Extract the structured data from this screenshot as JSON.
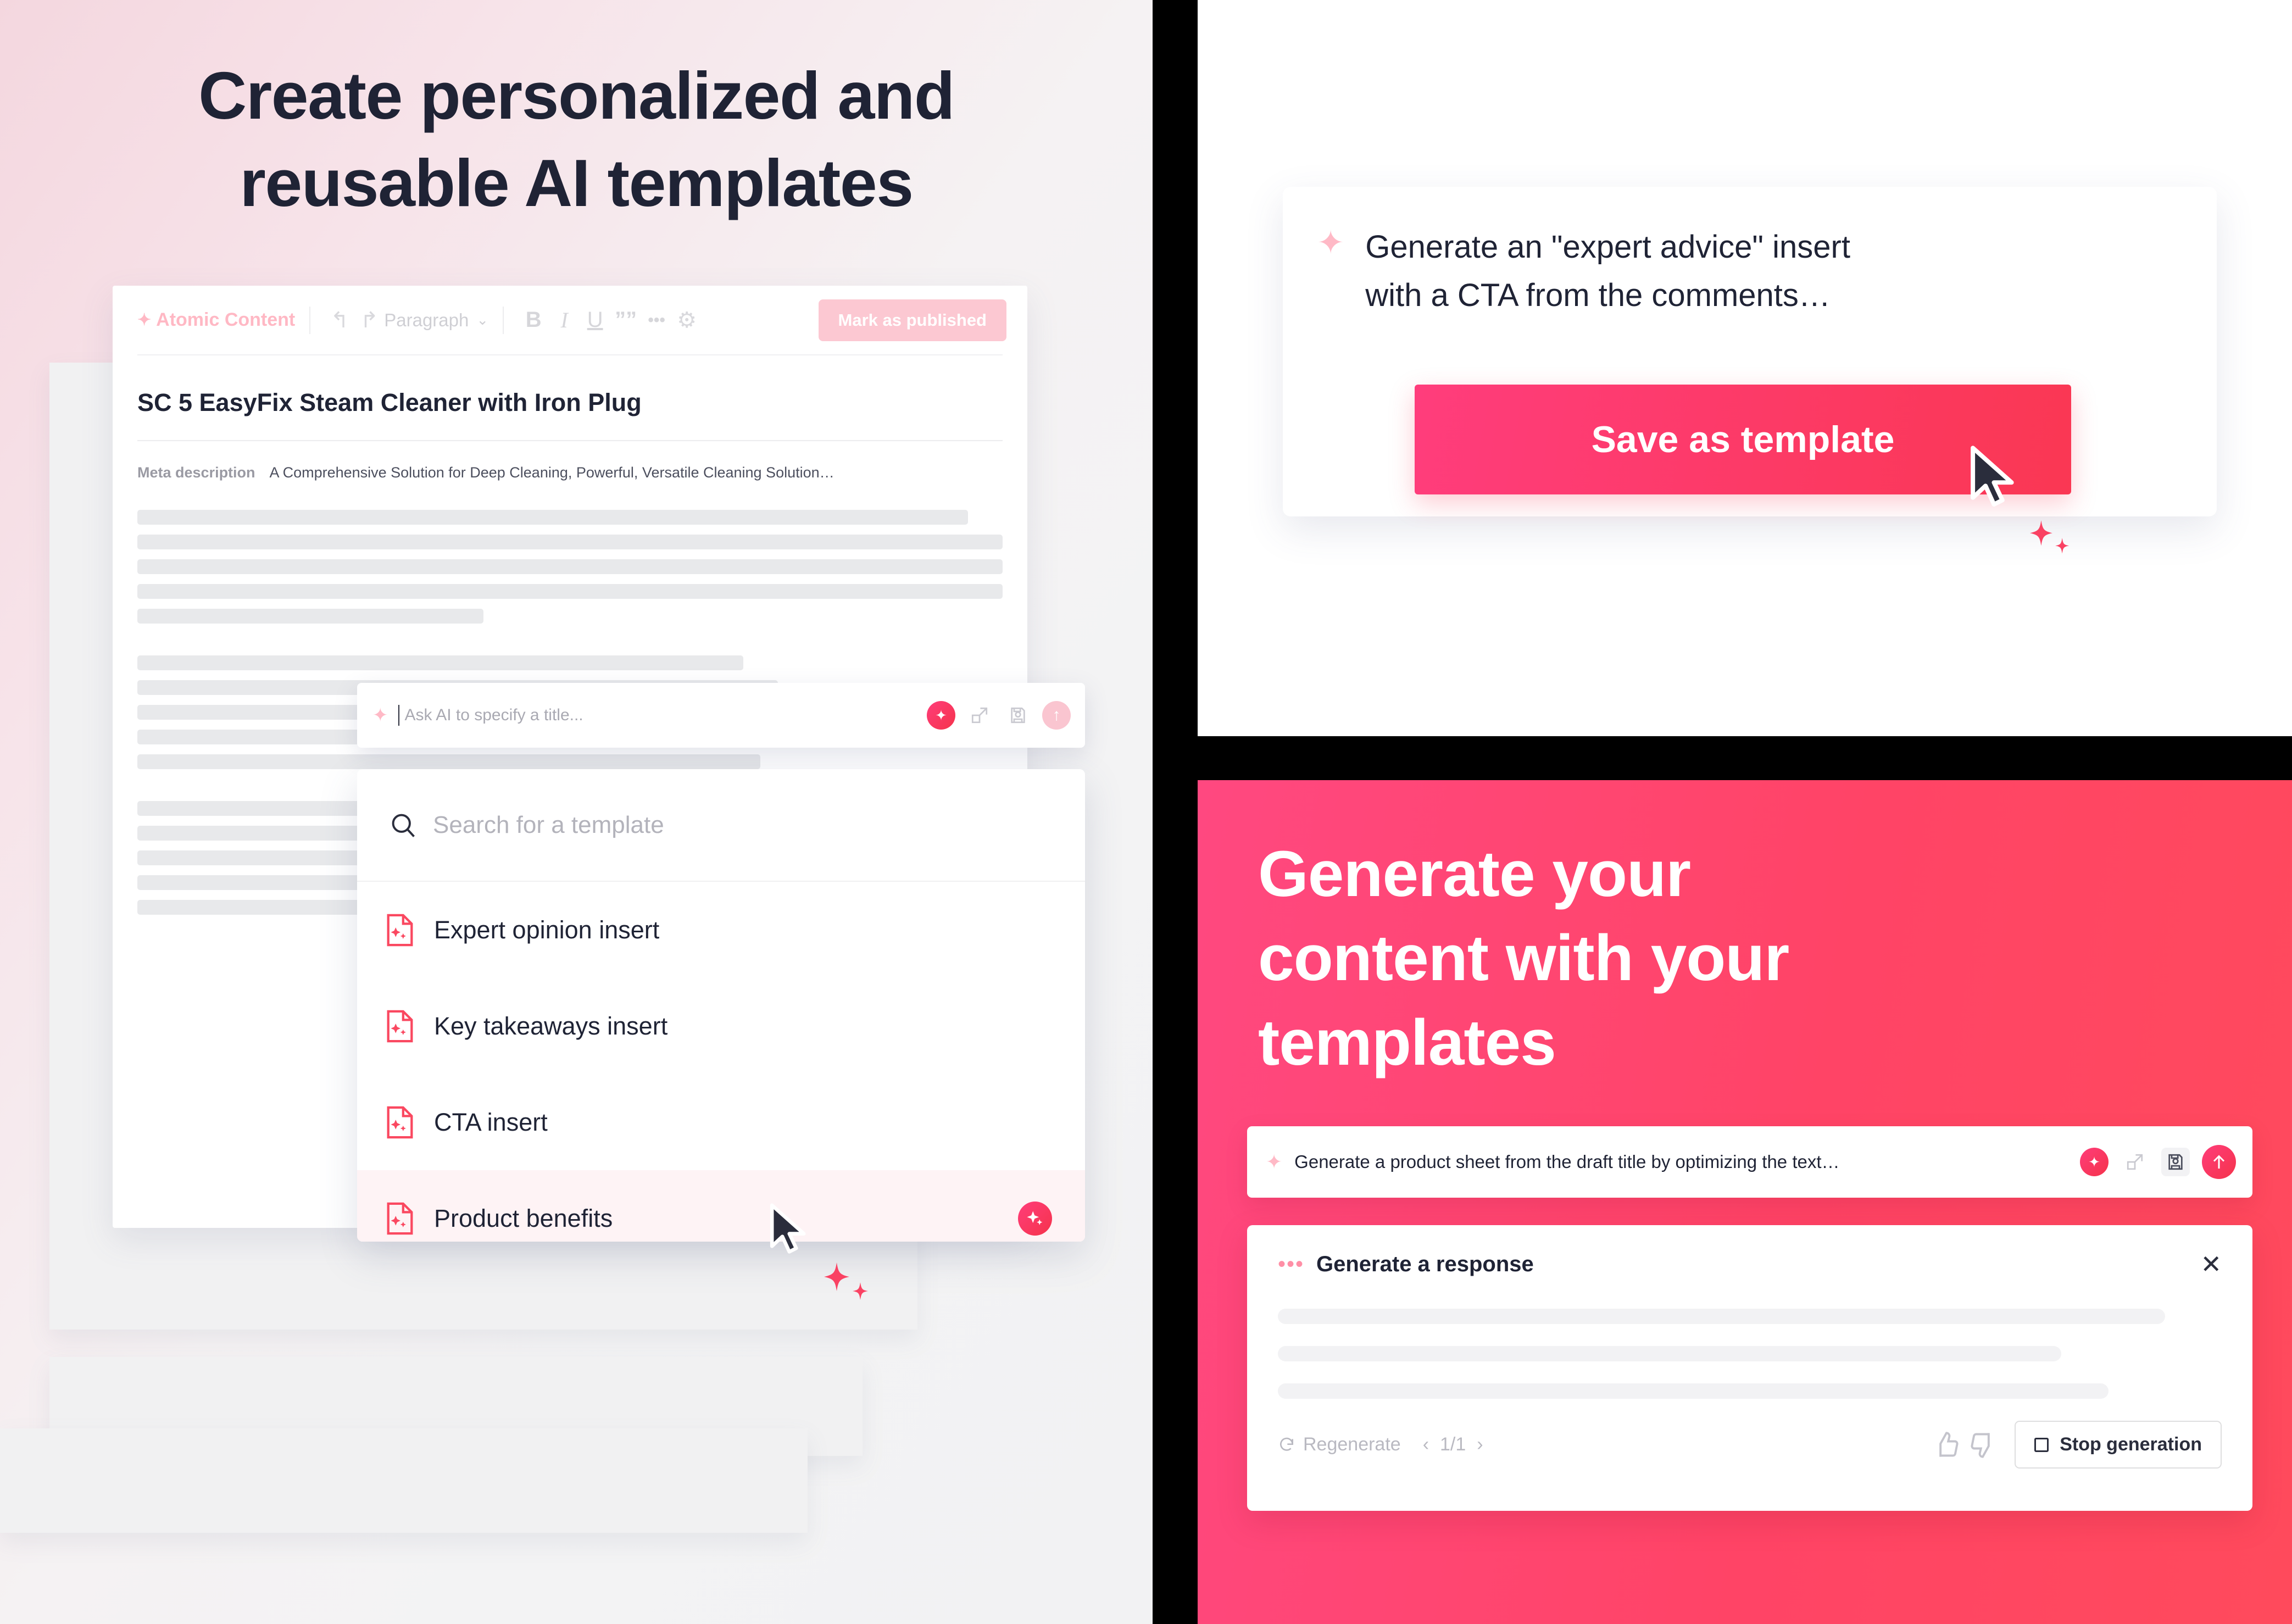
{
  "left": {
    "headline_line1": "Create personalized and",
    "headline_line2": "reusable AI templates",
    "editor": {
      "brand": "Atomic Content",
      "undo_icon": "undo-icon",
      "redo_icon": "redo-icon",
      "paragraph_label": "Paragraph",
      "bold": "B",
      "italic": "I",
      "underline": "U",
      "quote": "””",
      "more": "•••",
      "settings_icon": "gear-icon",
      "publish_label": "Mark as published",
      "doc_title": "SC 5 EasyFix Steam Cleaner with Iron Plug",
      "meta_label": "Meta description",
      "meta_value": "A Comprehensive Solution for Deep Cleaning, Powerful, Versatile Cleaning Solution…",
      "body_blocks": [
        [
          96,
          100,
          100,
          100,
          40
        ],
        [
          70,
          74,
          76,
          72,
          72
        ],
        [
          70,
          74,
          76,
          72,
          72
        ]
      ]
    },
    "ai_bar": {
      "placeholder": "Ask AI to specify a title...",
      "actions": [
        "sparkle-icon",
        "expand-icon",
        "save-icon",
        "send-icon"
      ]
    },
    "template_panel": {
      "search_placeholder": "Search for a template",
      "items": [
        {
          "label": "Expert opinion insert",
          "active": false
        },
        {
          "label": "Key takeaways insert",
          "active": false
        },
        {
          "label": "CTA insert",
          "active": false
        },
        {
          "label": "Product benefits",
          "active": true
        }
      ]
    }
  },
  "top_right": {
    "prompt_line1": "Generate an \"expert advice\" insert",
    "prompt_line2": "with a CTA from the comments…",
    "save_button": "Save as template"
  },
  "bottom_right": {
    "headline_line1": "Generate your",
    "headline_line2": "content with your",
    "headline_line3": "templates",
    "prompt_text": "Generate a product sheet from the draft title by optimizing the text…",
    "prompt_actions": [
      "sparkle-icon",
      "expand-icon",
      "save-icon",
      "send-icon"
    ],
    "response_card": {
      "title": "Generate a response",
      "close_icon": "close-icon",
      "line_widths": [
        94,
        83,
        88
      ],
      "regenerate_label": "Regenerate",
      "pager_prev": "‹",
      "pager_value": "1/1",
      "pager_next": "›",
      "thumb_up_icon": "thumb-up-icon",
      "thumb_down_icon": "thumb-down-icon",
      "stop_label": "Stop generation"
    }
  },
  "colors": {
    "accent_pink": "#FF3D7A",
    "accent_red": "#F5334B",
    "panel_pink_left": "#FF4880",
    "panel_pink_right": "#FF4A5C",
    "ink": "#1F2335",
    "pale_pink": "#FCC8D2"
  }
}
